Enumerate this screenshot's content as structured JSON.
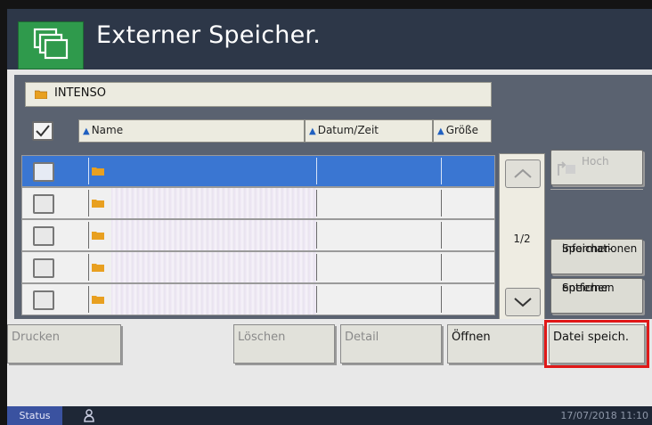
{
  "title": "Externer Speicher.",
  "path": "INTENSO",
  "columns": {
    "name": "Name",
    "date": "Datum/Zeit",
    "size": "Größe"
  },
  "rows": [
    {
      "selected": true
    },
    {
      "selected": false
    },
    {
      "selected": false
    },
    {
      "selected": false
    },
    {
      "selected": false
    }
  ],
  "pagination": "1/2",
  "side_buttons": {
    "up": "Hoch",
    "memory_info_1": "Speicher-",
    "memory_info_2": "informationen",
    "remove_1": "Speicher",
    "remove_2": "entfernen"
  },
  "bottom_buttons": {
    "print": "Drucken",
    "delete": "Löschen",
    "detail": "Detail",
    "open": "Öffnen",
    "save_file": "Datei speich."
  },
  "status": {
    "label": "Status",
    "datetime": "17/07/2018 11:10"
  },
  "colors": {
    "accent_green": "#2f9a4c",
    "selection_blue": "#3a76d2",
    "highlight_red": "#e01818"
  }
}
